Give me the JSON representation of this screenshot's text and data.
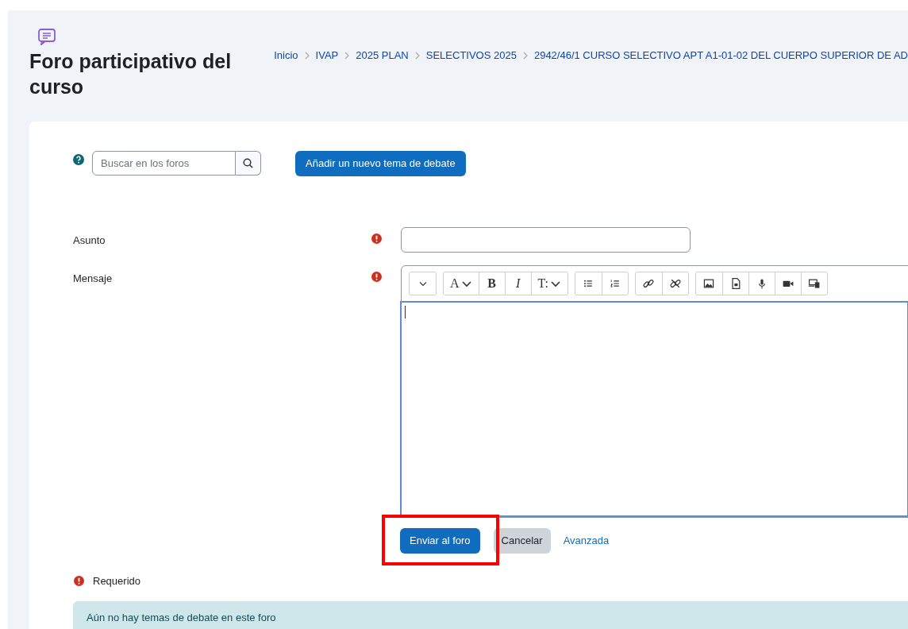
{
  "page_title": "Foro participativo del curso",
  "breadcrumb": [
    "Inicio",
    "IVAP",
    "2025 PLAN",
    "SELECTIVOS 2025",
    "2942/46/1 CURSO SELECTIVO APT A1-01-02 DEL CUERPO SUPERIOR DE AD"
  ],
  "search": {
    "placeholder": "Buscar en los foros"
  },
  "add_button": "Añadir un nuevo tema de debate",
  "form": {
    "fields": [
      {
        "label": "Asunto",
        "kind": "input",
        "required": true
      },
      {
        "label": "Mensaje",
        "kind": "editor",
        "required": true
      }
    ],
    "toolbar": [
      [
        {
          "kind": "caret"
        }
      ],
      [
        {
          "kind": "font",
          "label": "A"
        },
        {
          "kind": "bold",
          "label": "B"
        },
        {
          "kind": "italic",
          "label": "I"
        },
        {
          "kind": "heading",
          "label": "T:"
        }
      ],
      [
        {
          "kind": "bullet-list"
        },
        {
          "kind": "numbered-list"
        }
      ],
      [
        {
          "kind": "link"
        },
        {
          "kind": "unlink"
        }
      ],
      [
        {
          "kind": "image"
        },
        {
          "kind": "file"
        },
        {
          "kind": "microphone"
        },
        {
          "kind": "video"
        },
        {
          "kind": "screen"
        }
      ]
    ],
    "buttons": [
      {
        "label": "Enviar al foro",
        "kind": "primary",
        "highlighted": true
      },
      {
        "label": "Cancelar",
        "kind": "secondary",
        "highlighted": false
      },
      {
        "label": "Avanzada",
        "kind": "link",
        "highlighted": false
      }
    ],
    "required_note": "Requerido"
  },
  "notice": "Aún no hay temas de debate en este foro"
}
